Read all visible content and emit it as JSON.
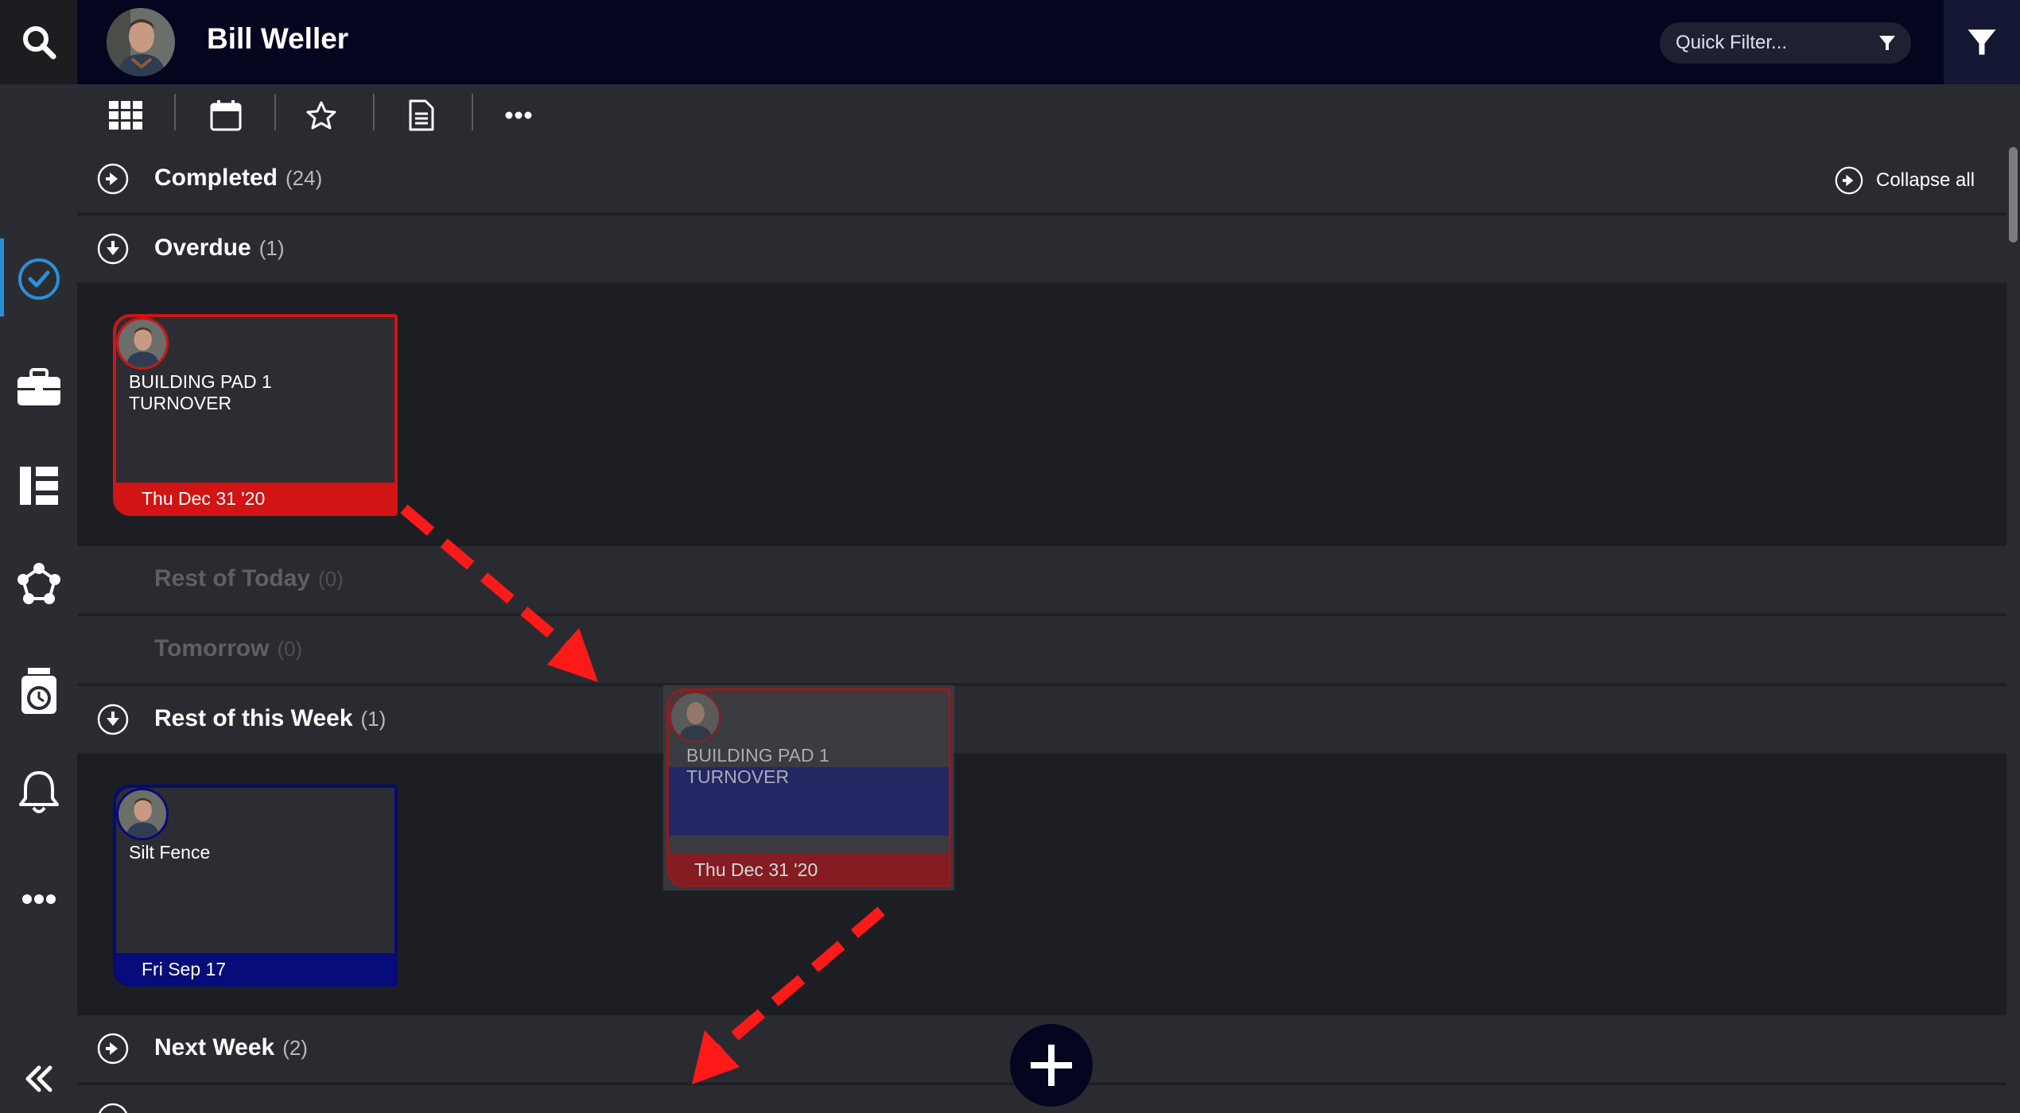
{
  "header": {
    "user_name": "Bill Weller",
    "quick_filter_placeholder": "Quick Filter..."
  },
  "sidebar": {
    "items": [
      {
        "icon": "search-icon"
      },
      {
        "icon": "check-circle-icon",
        "active": true
      },
      {
        "icon": "briefcase-icon"
      },
      {
        "icon": "board-icon"
      },
      {
        "icon": "network-icon"
      },
      {
        "icon": "timer-device-icon"
      },
      {
        "icon": "bell-icon"
      },
      {
        "icon": "more-icon"
      },
      {
        "icon": "collapse-sidebar-icon"
      }
    ]
  },
  "toolbar": {
    "items": [
      "grid-icon",
      "calendar-icon",
      "star-icon",
      "document-icon",
      "more-icon"
    ]
  },
  "groups": [
    {
      "label": "Completed",
      "count": "(24)",
      "state": "collapsed"
    },
    {
      "label": "Overdue",
      "count": "(1)",
      "state": "expanded"
    },
    {
      "label": "Rest of Today",
      "count": "(0)",
      "state": "empty"
    },
    {
      "label": "Tomorrow",
      "count": "(0)",
      "state": "empty"
    },
    {
      "label": "Rest of this Week",
      "count": "(1)",
      "state": "expanded"
    },
    {
      "label": "Next Week",
      "count": "(2)",
      "state": "collapsed"
    }
  ],
  "collapse_all_label": "Collapse all",
  "cards": {
    "overdue": {
      "title_line1": "BUILDING PAD 1",
      "title_line2": "TURNOVER",
      "date": "Thu Dec 31  '20",
      "status_color": "#d21414"
    },
    "week": {
      "title_line1": "Silt Fence",
      "title_line2": "",
      "date": "Fri Sep 17",
      "status_color": "#060c7a"
    },
    "dragging": {
      "title_line1": "BUILDING PAD 1",
      "title_line2": "TURNOVER",
      "date": "Thu Dec 31  '20"
    }
  },
  "colors": {
    "accent": "#2b8fd8",
    "header_bg": "#040620",
    "overdue": "#d21414",
    "upcoming": "#060c7a",
    "annotation_arrow": "#ff1a1a"
  }
}
